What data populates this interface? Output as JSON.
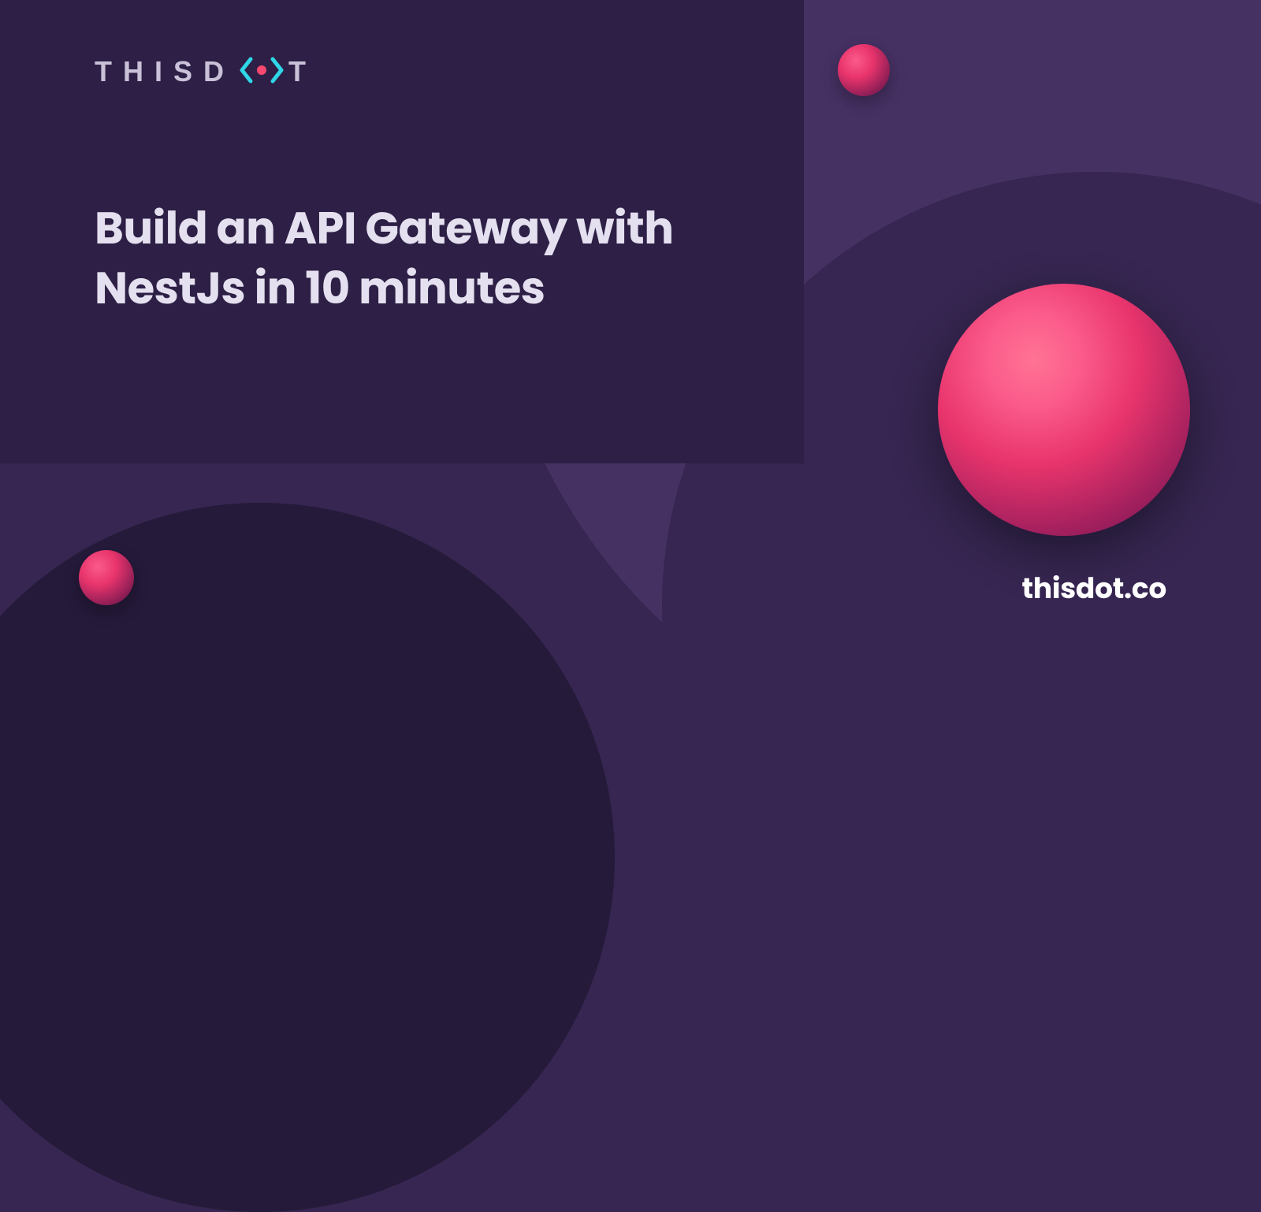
{
  "logo": {
    "text_before": "THISD",
    "text_after": "T",
    "icon_name": "thisdot-logo-icon"
  },
  "headline": "Build an API Gateway with NestJs in 10 minutes",
  "website_url": "thisdot.co",
  "colors": {
    "bg_dark": "#362651",
    "bg_panel": "#2d1f45",
    "bg_light_blob": "#463163",
    "bg_deep_blob": "#251a3a",
    "accent_pink": "#fb5b8b",
    "text_light": "#e4e0ef",
    "logo_text": "#c9c1d8"
  }
}
